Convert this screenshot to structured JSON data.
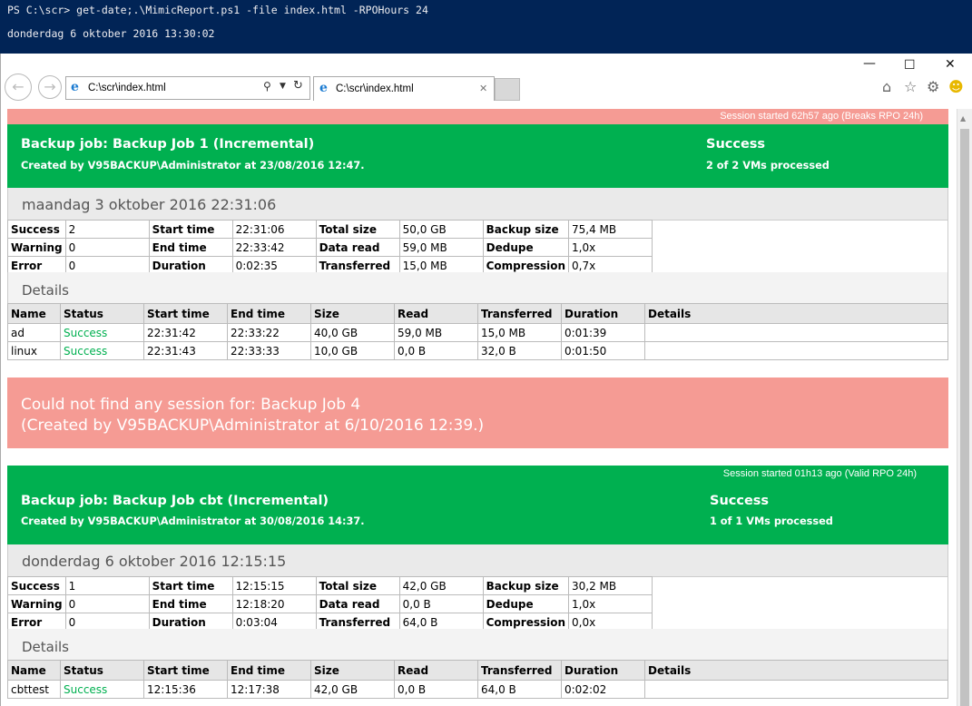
{
  "powershell": {
    "line1": "PS C:\\scr> get-date;.\\MimicReport.ps1 -file index.html -RPOHours 24",
    "line2": "donderdag 6 oktober 2016 13:30:02",
    "bg": "#012456"
  },
  "browser": {
    "address": "C:\\scr\\index.html",
    "tab_title": "C:\\scr\\index.html"
  },
  "jobs": [
    {
      "rpo_text": "Session started 62h57 ago (Breaks RPO 24h)",
      "rpo_color": "#f59b94",
      "title": "Backup job: Backup Job 1 (Incremental)",
      "created": "Created by V95BACKUP\\Administrator at 23/08/2016 12:47.",
      "status": "Success",
      "processed": "2 of 2 VMs processed",
      "date": "maandag 3 oktober 2016 22:31:06",
      "summary": [
        [
          "Success",
          "2",
          "Start time",
          "22:31:06",
          "Total size",
          "50,0 GB",
          "Backup size",
          "75,4 MB"
        ],
        [
          "Warning",
          "0",
          "End time",
          "22:33:42",
          "Data read",
          "59,0 MB",
          "Dedupe",
          "1,0x"
        ],
        [
          "Error",
          "0",
          "Duration",
          "0:02:35",
          "Transferred",
          "15,0 MB",
          "Compression",
          "0,7x"
        ]
      ],
      "details_title": "Details",
      "headers": [
        "Name",
        "Status",
        "Start time",
        "End time",
        "Size",
        "Read",
        "Transferred",
        "Duration",
        "Details"
      ],
      "rows": [
        [
          "ad",
          "Success",
          "22:31:42",
          "22:33:22",
          "40,0 GB",
          "59,0 MB",
          "15,0 MB",
          "0:01:39",
          ""
        ],
        [
          "linux",
          "Success",
          "22:31:43",
          "22:33:33",
          "10,0 GB",
          "0,0 B",
          "32,0 B",
          "0:01:50",
          ""
        ]
      ]
    },
    {
      "rpo_text": "Session started 01h13 ago (Valid RPO 24h)",
      "title": "Backup job: Backup Job cbt (Incremental)",
      "created": "Created by V95BACKUP\\Administrator at 30/08/2016 14:37.",
      "status": "Success",
      "processed": "1 of 1 VMs processed",
      "date": "donderdag 6 oktober 2016 12:15:15",
      "summary": [
        [
          "Success",
          "1",
          "Start time",
          "12:15:15",
          "Total size",
          "42,0 GB",
          "Backup size",
          "30,2 MB"
        ],
        [
          "Warning",
          "0",
          "End time",
          "12:18:20",
          "Data read",
          "0,0 B",
          "Dedupe",
          "1,0x"
        ],
        [
          "Error",
          "0",
          "Duration",
          "0:03:04",
          "Transferred",
          "64,0 B",
          "Compression",
          "0,0x"
        ]
      ],
      "details_title": "Details",
      "headers": [
        "Name",
        "Status",
        "Start time",
        "End time",
        "Size",
        "Read",
        "Transferred",
        "Duration",
        "Details"
      ],
      "rows": [
        [
          "cbttest",
          "Success",
          "12:15:36",
          "12:17:38",
          "42,0 GB",
          "0,0 B",
          "64,0 B",
          "0:02:02",
          ""
        ]
      ]
    }
  ],
  "missing": {
    "line1": "Could not find any session for: Backup Job 4",
    "line2": "(Created by V95BACKUP\\Administrator at 6/10/2016 12:39.)",
    "color": "#f59b94"
  },
  "colors": {
    "success_green": "#00b050",
    "error_red": "#f59b94"
  }
}
